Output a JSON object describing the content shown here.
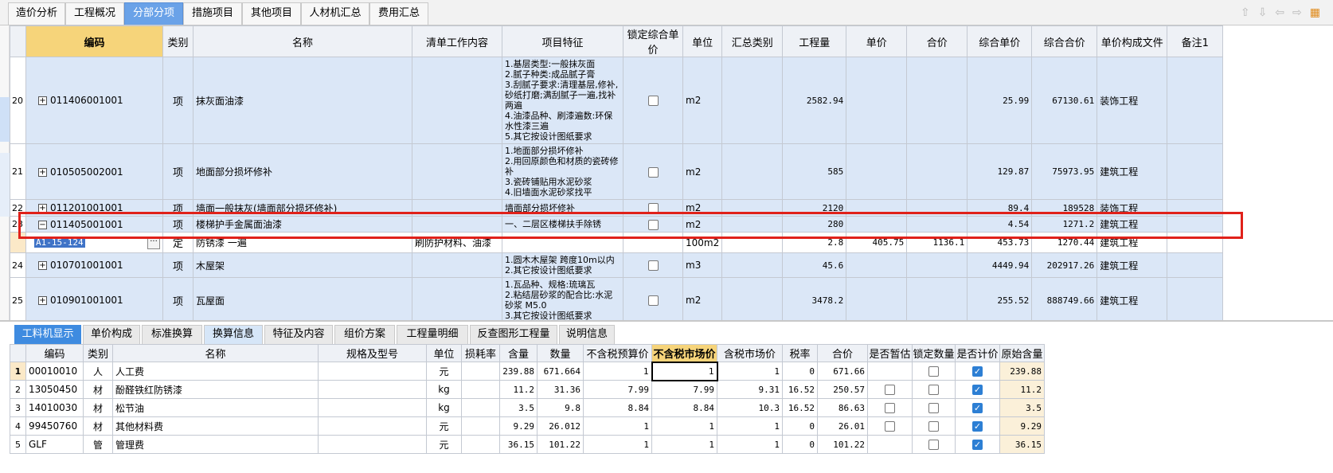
{
  "top_tabs": [
    "造价分析",
    "工程概况",
    "分部分项",
    "措施项目",
    "其他项目",
    "人材机汇总",
    "费用汇总"
  ],
  "active_top_tab": 2,
  "nav_icons": [
    "arrow-up-icon",
    "arrow-down-icon",
    "arrow-left-icon",
    "arrow-right-icon",
    "toolbar-menu-icon"
  ],
  "main_grid": {
    "headers": [
      "编码",
      "类别",
      "名称",
      "清单工作内容",
      "项目特征",
      "锁定综合单价",
      "单位",
      "汇总类别",
      "工程量",
      "单价",
      "合价",
      "综合单价",
      "综合合价",
      "单价构成文件",
      "备注1"
    ],
    "rows": [
      {
        "rn": "20",
        "code": "011406001001",
        "type": "项",
        "name": "抹灰面油漆",
        "content": "",
        "feature": "1.基层类型:一般抹灰面\n2.腻子种类:成品腻子膏\n3.刮腻子要求:清理基层,修补,砂纸打磨;满刮腻子一遍,找补两遍\n4.油漆品种、刷漆遍数:环保水性漆三遍\n5.其它按设计图纸要求",
        "unit": "m2",
        "qty": "2582.94",
        "price": "",
        "total": "",
        "comp_price": "25.99",
        "comp_total": "67130.61",
        "file": "装饰工程"
      },
      {
        "rn": "21",
        "code": "010505002001",
        "type": "项",
        "name": "地面部分损坏修补",
        "content": "",
        "feature": "1.地面部分损坏修补\n2.用回原颜色和材质的瓷砖修补\n3.瓷砖铺贴用水泥砂浆\n4.旧墙面水泥砂浆找平",
        "unit": "m2",
        "qty": "585",
        "price": "",
        "total": "",
        "comp_price": "129.87",
        "comp_total": "75973.95",
        "file": "建筑工程"
      },
      {
        "rn": "22",
        "code": "011201001001",
        "type": "项",
        "name": "墙面一般抹灰(墙面部分损坏修补)",
        "content": "",
        "feature": "墙面部分损坏修补",
        "unit": "m2",
        "qty": "2120",
        "price": "",
        "total": "",
        "comp_price": "89.4",
        "comp_total": "189528",
        "file": "装饰工程"
      },
      {
        "rn": "23",
        "code": "011405001001",
        "type": "项",
        "name": "楼梯护手金属面油漆",
        "content": "",
        "feature": "一、二层区楼梯扶手除锈",
        "unit": "m2",
        "qty": "280",
        "price": "",
        "total": "",
        "comp_price": "4.54",
        "comp_total": "1271.2",
        "file": "建筑工程"
      },
      {
        "rn": "",
        "code": "A1-15-124",
        "type": "定",
        "name": "防锈漆 一遍",
        "content": "刷防护材料、油漆",
        "feature": "",
        "unit": "100m2",
        "qty": "2.8",
        "price": "405.75",
        "total": "1136.1",
        "comp_price": "453.73",
        "comp_total": "1270.44",
        "file": "建筑工程"
      },
      {
        "rn": "24",
        "code": "010701001001",
        "type": "项",
        "name": "木屋架",
        "content": "",
        "feature": "1.圆木木屋架 跨度10m以内\n2.其它按设计图纸要求",
        "unit": "m3",
        "qty": "45.6",
        "price": "",
        "total": "",
        "comp_price": "4449.94",
        "comp_total": "202917.26",
        "file": "建筑工程"
      },
      {
        "rn": "25",
        "code": "010901001001",
        "type": "项",
        "name": "瓦屋面",
        "content": "",
        "feature": "1.瓦品种、规格:琉璃瓦\n2.粘结层砂浆的配合比:水泥砂浆 M5.0\n3.其它按设计图纸要求",
        "unit": "m2",
        "qty": "3478.2",
        "price": "",
        "total": "",
        "comp_price": "255.52",
        "comp_total": "888749.66",
        "file": "建筑工程"
      }
    ]
  },
  "bottom_tabs": [
    "工料机显示",
    "单价构成",
    "标准换算",
    "换算信息",
    "特征及内容",
    "组价方案",
    "工程量明细",
    "反查图形工程量",
    "说明信息"
  ],
  "active_bottom_tab": 0,
  "sub_grid": {
    "headers": [
      "编码",
      "类别",
      "名称",
      "规格及型号",
      "单位",
      "损耗率",
      "含量",
      "数量",
      "不含税预算价",
      "不含税市场价",
      "含税市场价",
      "税率",
      "合价",
      "是否暂估",
      "锁定数量",
      "是否计价",
      "原始含量"
    ],
    "rows": [
      {
        "rn": "1",
        "code": "00010010",
        "type": "人",
        "name": "人工费",
        "spec": "",
        "unit": "元",
        "loss": "",
        "content": "239.88",
        "qty": "671.664",
        "budget": "1",
        "market": "1",
        "taxmarket": "1",
        "rate": "0",
        "total": "671.66",
        "orig": "239.88",
        "est": false,
        "lock": false,
        "priced": true,
        "has_est": false
      },
      {
        "rn": "2",
        "code": "13050450",
        "type": "材",
        "name": "酚醛铁红防锈漆",
        "spec": "",
        "unit": "kg",
        "loss": "",
        "content": "11.2",
        "qty": "31.36",
        "budget": "7.99",
        "market": "7.99",
        "taxmarket": "9.31",
        "rate": "16.52",
        "total": "250.57",
        "orig": "11.2",
        "est": false,
        "lock": false,
        "priced": true,
        "has_est": true
      },
      {
        "rn": "3",
        "code": "14010030",
        "type": "材",
        "name": "松节油",
        "spec": "",
        "unit": "kg",
        "loss": "",
        "content": "3.5",
        "qty": "9.8",
        "budget": "8.84",
        "market": "8.84",
        "taxmarket": "10.3",
        "rate": "16.52",
        "total": "86.63",
        "orig": "3.5",
        "est": false,
        "lock": false,
        "priced": true,
        "has_est": true
      },
      {
        "rn": "4",
        "code": "99450760",
        "type": "材",
        "name": "其他材料费",
        "spec": "",
        "unit": "元",
        "loss": "",
        "content": "9.29",
        "qty": "26.012",
        "budget": "1",
        "market": "1",
        "taxmarket": "1",
        "rate": "0",
        "total": "26.01",
        "orig": "9.29",
        "est": false,
        "lock": false,
        "priced": true,
        "has_est": true
      },
      {
        "rn": "5",
        "code": "GLF",
        "type": "管",
        "name": "管理费",
        "spec": "",
        "unit": "元",
        "loss": "",
        "content": "36.15",
        "qty": "101.22",
        "budget": "1",
        "market": "1",
        "taxmarket": "1",
        "rate": "0",
        "total": "101.22",
        "orig": "36.15",
        "est": false,
        "lock": false,
        "priced": true,
        "has_est": false
      }
    ]
  }
}
